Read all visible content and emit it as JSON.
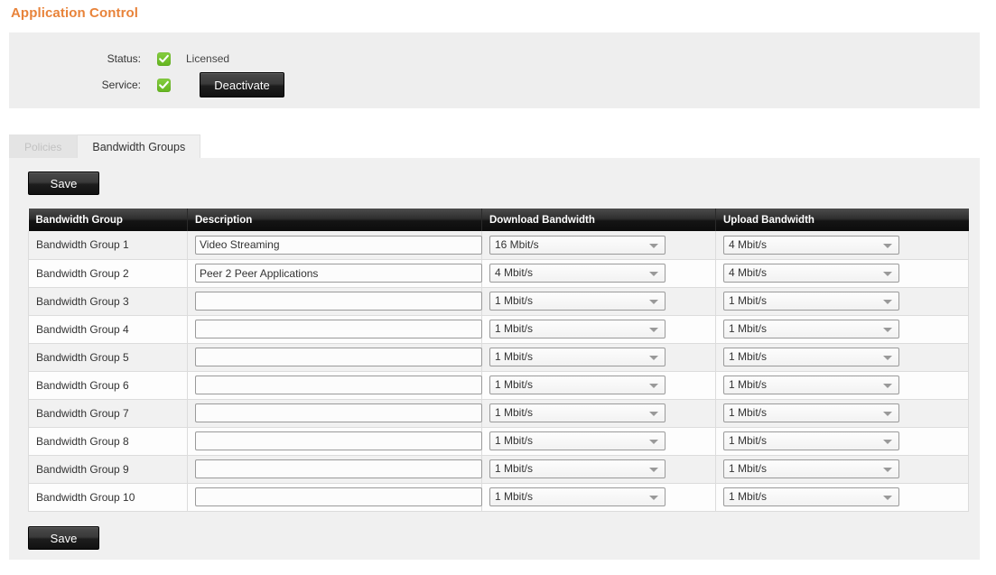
{
  "page": {
    "title": "Application Control",
    "title_color": "#e8833a"
  },
  "status_panel": {
    "rows": [
      {
        "label": "Status:",
        "checked": true,
        "value_text": "Licensed",
        "icon": "checkbox-checked-icon"
      },
      {
        "label": "Service:",
        "checked": true,
        "value_text": "",
        "icon": "checkbox-checked-icon"
      }
    ],
    "deactivate_label": "Deactivate"
  },
  "tabs": [
    {
      "label": "Policies",
      "active": false
    },
    {
      "label": "Bandwidth Groups",
      "active": true
    }
  ],
  "toolbar": {
    "save_label_top": "Save",
    "save_label_bottom": "Save"
  },
  "table": {
    "columns": [
      "Bandwidth Group",
      "Description",
      "Download Bandwidth",
      "Upload Bandwidth"
    ],
    "description_placeholder": "",
    "select_arrow_icon": "chevron-down-icon",
    "rows": [
      {
        "group": "Bandwidth Group 1",
        "description": "Video Streaming",
        "download": "16 Mbit/s",
        "upload": "4 Mbit/s"
      },
      {
        "group": "Bandwidth Group 2",
        "description": "Peer 2 Peer Applications",
        "download": "4 Mbit/s",
        "upload": "4 Mbit/s"
      },
      {
        "group": "Bandwidth Group 3",
        "description": "",
        "download": "1 Mbit/s",
        "upload": "1 Mbit/s"
      },
      {
        "group": "Bandwidth Group 4",
        "description": "",
        "download": "1 Mbit/s",
        "upload": "1 Mbit/s"
      },
      {
        "group": "Bandwidth Group 5",
        "description": "",
        "download": "1 Mbit/s",
        "upload": "1 Mbit/s"
      },
      {
        "group": "Bandwidth Group 6",
        "description": "",
        "download": "1 Mbit/s",
        "upload": "1 Mbit/s"
      },
      {
        "group": "Bandwidth Group 7",
        "description": "",
        "download": "1 Mbit/s",
        "upload": "1 Mbit/s"
      },
      {
        "group": "Bandwidth Group 8",
        "description": "",
        "download": "1 Mbit/s",
        "upload": "1 Mbit/s"
      },
      {
        "group": "Bandwidth Group 9",
        "description": "",
        "download": "1 Mbit/s",
        "upload": "1 Mbit/s"
      },
      {
        "group": "Bandwidth Group 10",
        "description": "",
        "download": "1 Mbit/s",
        "upload": "1 Mbit/s"
      }
    ]
  },
  "colors": {
    "accent": "#e8833a",
    "status_ok": "#72c02c",
    "panel_bg": "#eeeeee",
    "content_bg": "#f0f0f0",
    "header_bg": "#141414"
  }
}
